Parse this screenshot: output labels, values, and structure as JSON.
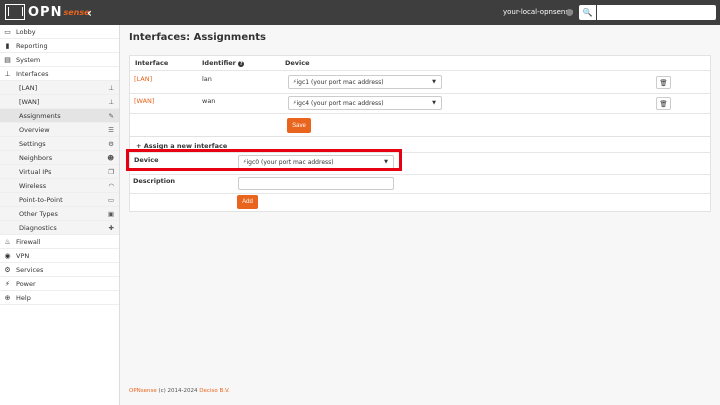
{
  "topbar": {
    "logo_text": "OPN",
    "logo_sense": "sense",
    "collapse_glyph": "‹",
    "hostname": "your-local-opnsense",
    "search_icon": "🔍",
    "search_value": ""
  },
  "sidebar": {
    "items": [
      {
        "label": "Lobby",
        "icon": "laptop-icon",
        "glyph": "▭",
        "level": "top"
      },
      {
        "label": "Reporting",
        "icon": "chart-icon",
        "glyph": "▮",
        "level": "top"
      },
      {
        "label": "System",
        "icon": "server-icon",
        "glyph": "▤",
        "level": "top"
      },
      {
        "label": "Interfaces",
        "icon": "sitemap-icon",
        "glyph": "⊥",
        "level": "top"
      },
      {
        "label": "[LAN]",
        "icon": "sitemap-icon",
        "glyph": "⊥",
        "level": "sub"
      },
      {
        "label": "[WAN]",
        "icon": "sitemap-icon",
        "glyph": "⊥",
        "level": "sub"
      },
      {
        "label": "Assignments",
        "icon": "pencil-icon",
        "glyph": "✎",
        "level": "sub",
        "active": true
      },
      {
        "label": "Overview",
        "icon": "list-icon",
        "glyph": "☰",
        "level": "sub"
      },
      {
        "label": "Settings",
        "icon": "cogs-icon",
        "glyph": "⚙",
        "level": "sub"
      },
      {
        "label": "Neighbors",
        "icon": "users-icon",
        "glyph": "☻",
        "level": "sub"
      },
      {
        "label": "Virtual IPs",
        "icon": "copy-icon",
        "glyph": "❐",
        "level": "sub"
      },
      {
        "label": "Wireless",
        "icon": "wifi-icon",
        "glyph": "◠",
        "level": "sub"
      },
      {
        "label": "Point-to-Point",
        "icon": "drive-icon",
        "glyph": "▭",
        "level": "sub"
      },
      {
        "label": "Other Types",
        "icon": "archive-icon",
        "glyph": "▣",
        "level": "sub"
      },
      {
        "label": "Diagnostics",
        "icon": "medkit-icon",
        "glyph": "✚",
        "level": "sub"
      },
      {
        "label": "Firewall",
        "icon": "fire-icon",
        "glyph": "♨",
        "level": "top"
      },
      {
        "label": "VPN",
        "icon": "globe-icon",
        "glyph": "◉",
        "level": "top"
      },
      {
        "label": "Services",
        "icon": "cog-icon",
        "glyph": "⚙",
        "level": "top"
      },
      {
        "label": "Power",
        "icon": "plug-icon",
        "glyph": "⚡",
        "level": "top"
      },
      {
        "label": "Help",
        "icon": "lifebuoy-icon",
        "glyph": "⊕",
        "level": "top"
      }
    ]
  },
  "main": {
    "title": "Interfaces: Assignments",
    "table": {
      "headers": {
        "interface": "Interface",
        "identifier": "Identifier",
        "identifier_help": "?",
        "device": "Device"
      },
      "rows": [
        {
          "interface": "[LAN]",
          "identifier": "lan",
          "device": "igc1 (your port mac address)"
        },
        {
          "interface": "[WAN]",
          "identifier": "wan",
          "device": "igc4 (your port mac address)"
        }
      ],
      "save_label": "Save",
      "trash_glyph": "🗑"
    },
    "assign": {
      "title": "Assign a new interface",
      "plus_glyph": "+",
      "device_label": "Device",
      "device_value": "igc0 (your port mac address)",
      "description_label": "Description",
      "description_value": "",
      "add_label": "Add"
    },
    "select_caret": "▼",
    "plug_glyph": "⚡"
  },
  "footer": {
    "brand": "OPNsense",
    "copyright": " (c) 2014-2024 ",
    "company": "Deciso B.V."
  }
}
